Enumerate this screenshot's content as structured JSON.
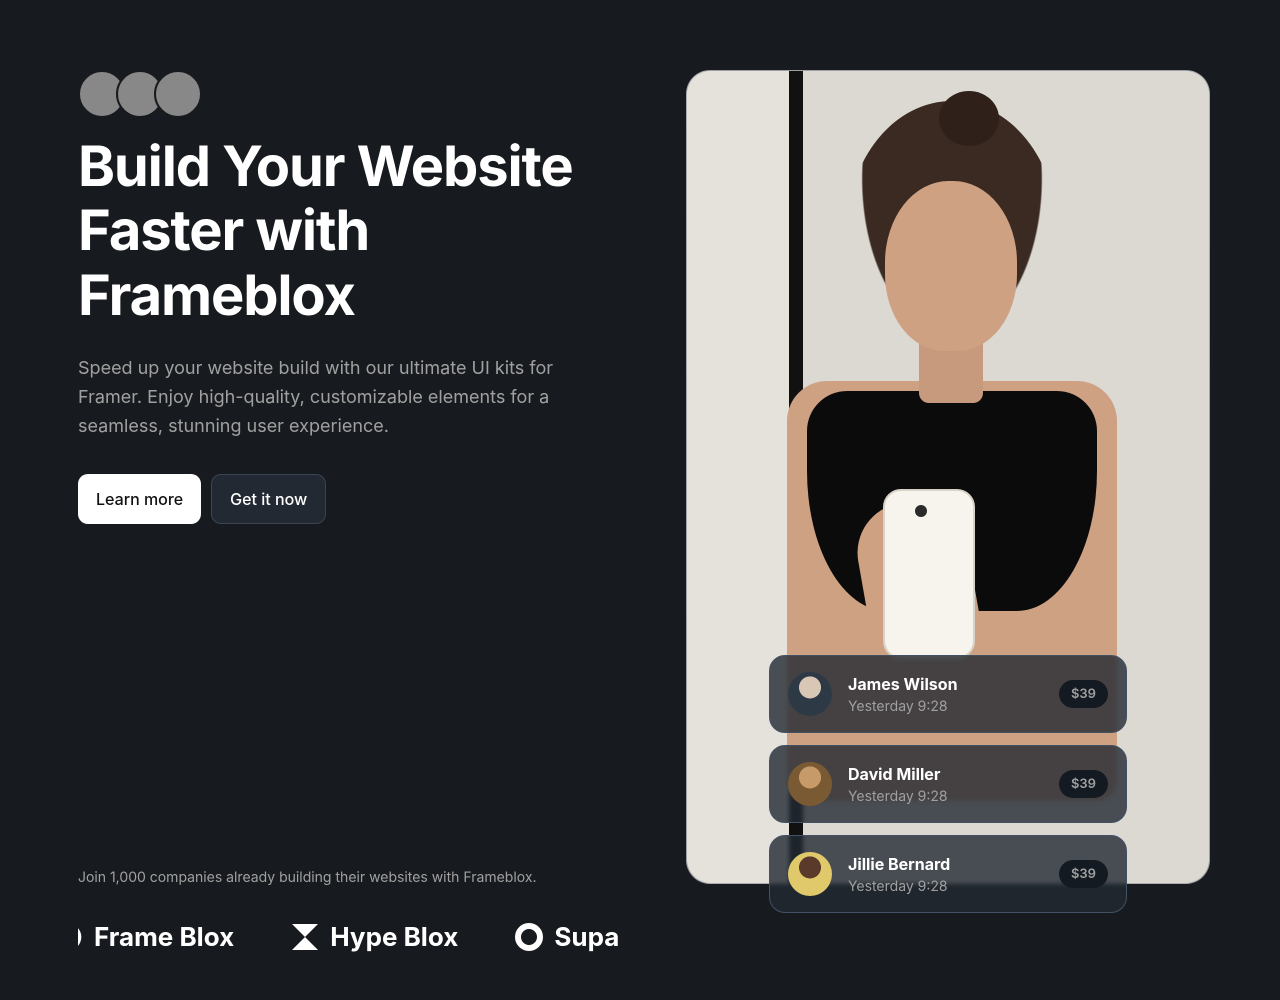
{
  "hero": {
    "headline": "Build Your Website Faster with Frameblox",
    "sub": "Speed up your website build with our ultimate UI kits for Framer. Enjoy high-quality, customizable elements for a seamless, stunning user experience."
  },
  "cta": {
    "primary": "Learn more",
    "secondary": "Get it now"
  },
  "social": {
    "caption": "Join 1,000 companies already building their websites with Frameblox.",
    "brands": [
      "Frame Blox",
      "Hype Blox",
      "Supa"
    ]
  },
  "cards": [
    {
      "name": "James Wilson",
      "time": "Yesterday 9:28",
      "price": "$39"
    },
    {
      "name": "David Miller",
      "time": "Yesterday 9:28",
      "price": "$39"
    },
    {
      "name": "Jillie Bernard",
      "time": "Yesterday 9:28",
      "price": "$39"
    }
  ]
}
